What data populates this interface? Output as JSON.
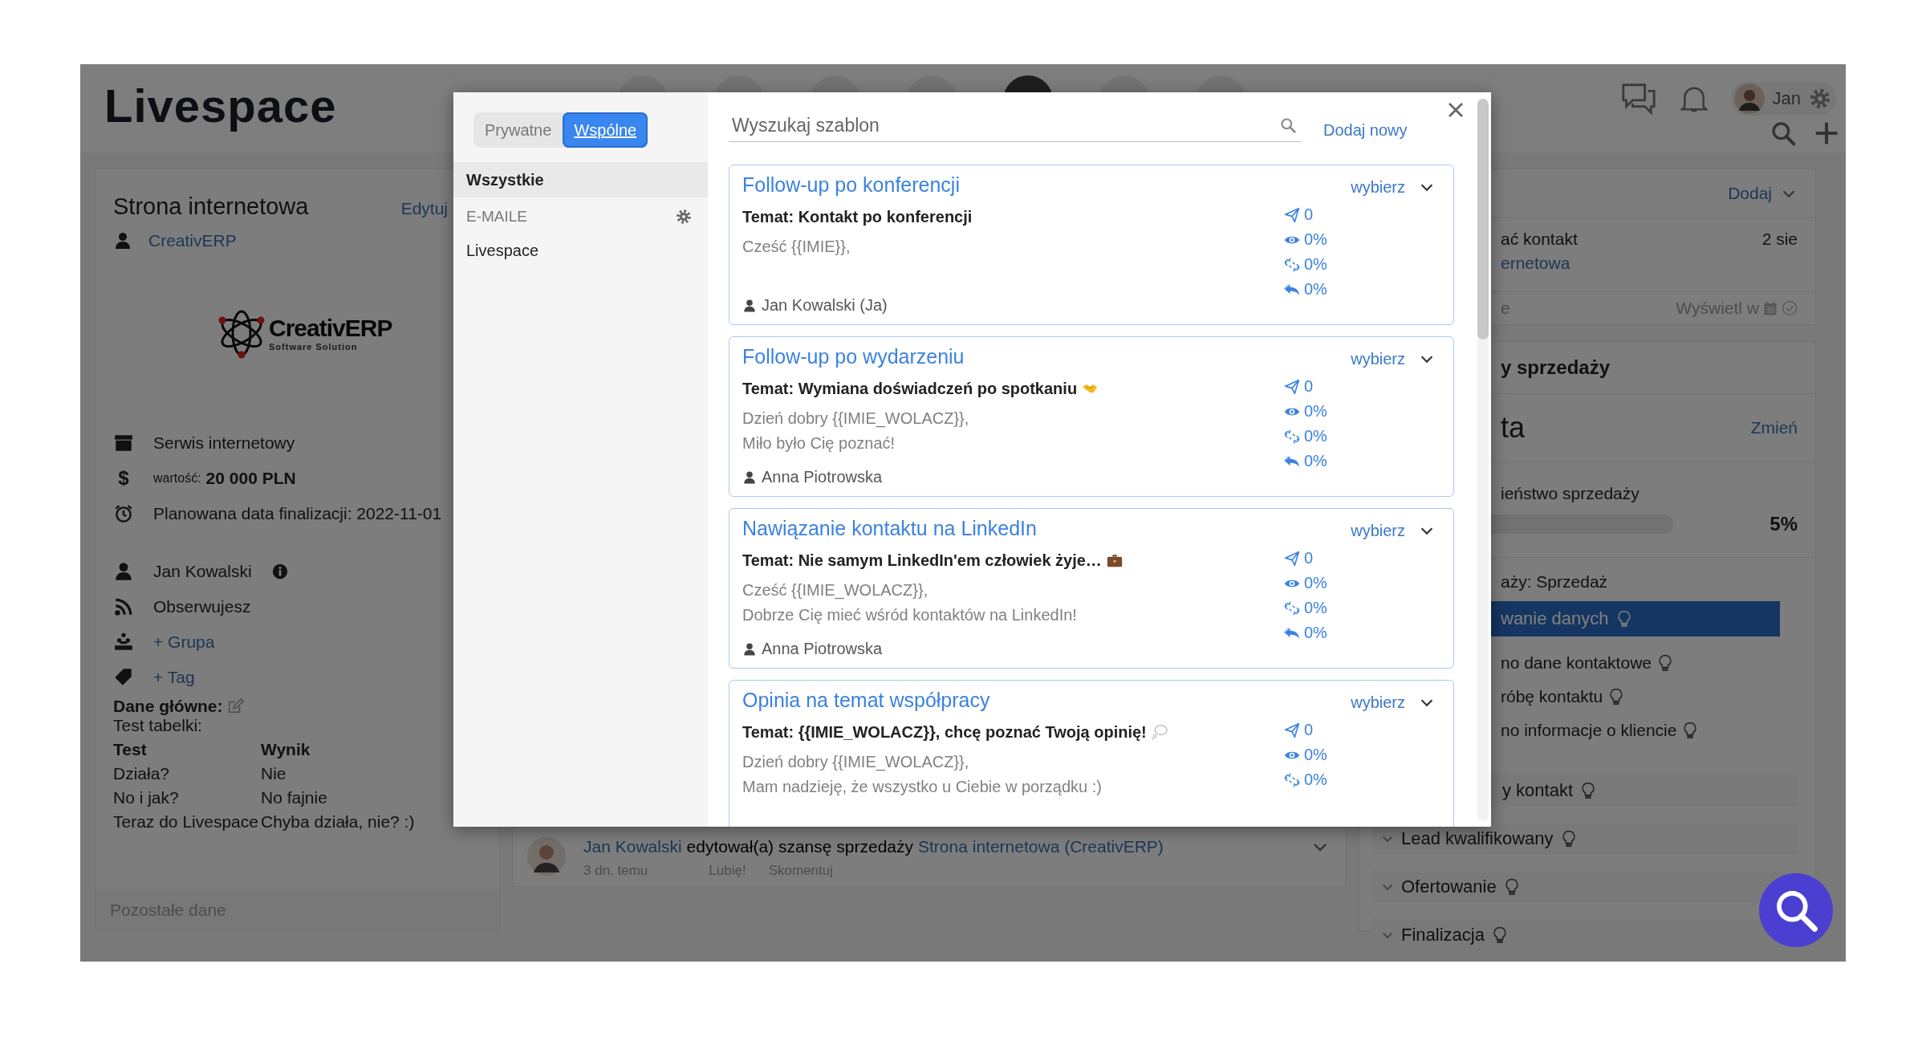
{
  "header": {
    "logo": "Livespace",
    "user_name": "Jan",
    "nav_buttons": [
      {
        "selected": false
      },
      {
        "selected": false
      },
      {
        "selected": false
      },
      {
        "selected": false
      },
      {
        "selected": true
      },
      {
        "selected": false
      },
      {
        "selected": false
      }
    ]
  },
  "deal": {
    "title": "Strona internetowa",
    "edit": "Edytuj",
    "company": "CreativERP",
    "company_logo": {
      "name": "CreativERP",
      "tagline": "Software Solution"
    },
    "details": [
      {
        "kind": "archive",
        "text": "Serwis internetowy"
      },
      {
        "kind": "value",
        "symbol": "$",
        "label": "wartość:",
        "value": "20 000 PLN"
      },
      {
        "kind": "alarm",
        "text": "Planowana data finalizacji: 2022-11-01"
      },
      {
        "kind": "owner",
        "text": "Jan Kowalski"
      },
      {
        "kind": "rss",
        "text": "Obserwujesz"
      },
      {
        "kind": "group",
        "text": "+ Grupa",
        "link": true
      },
      {
        "kind": "tag",
        "text": "+ Tag",
        "link": true
      }
    ],
    "main_data_label": "Dane główne:",
    "table_label": "Test tabelki:",
    "table": {
      "columns": [
        "Test",
        "Wynik"
      ],
      "rows": [
        [
          "Działa?",
          "Nie"
        ],
        [
          "No i jak?",
          "No fajnie"
        ],
        [
          "Teraz do Livespace",
          "Chyba działa, nie? :)"
        ]
      ]
    },
    "more": "Pozostałe dane"
  },
  "activity": {
    "author": "Jan Kowalski",
    "action": "edytował(a) szansę sprzedaży",
    "target": "Strona internetowa (CreativERP)",
    "time": "3 dn. temu",
    "like": "Lubię!",
    "comment": "Skomentuj"
  },
  "side": {
    "tasks": {
      "add": "Dodaj",
      "task_title": "ać kontakt",
      "task_date": "2 sie",
      "task_link": "ernetowa",
      "footer_left": "e",
      "footer_right": "Wyświetl w"
    },
    "pipeline": {
      "title": "y sprzedaży",
      "stage_name": "ta",
      "change": "Zmień",
      "probability_label": "ieństwo sprzedaży",
      "probability": "5%",
      "process_label": "aży: Sprzedaż",
      "stages": [
        {
          "name": "wanie danych",
          "selected": true,
          "tasks": [
            "no dane kontaktowe",
            "róbę kontaktu",
            "no informacje o kliencie"
          ]
        },
        {
          "name": "y kontakt",
          "selected": false
        },
        {
          "name": "Lead kwalifikowany",
          "selected": false
        },
        {
          "name": "Ofertowanie",
          "selected": false
        },
        {
          "name": "Finalizacja",
          "selected": false
        }
      ]
    }
  },
  "template_picker": {
    "scope_tabs": [
      {
        "label": "Prywatne",
        "selected": false
      },
      {
        "label": "Wspólne",
        "selected": true
      }
    ],
    "categories": [
      {
        "kind": "item",
        "label": "Wszystkie",
        "selected": true
      },
      {
        "kind": "section",
        "label": "E-MAILE"
      },
      {
        "kind": "item",
        "label": "Livespace",
        "selected": false
      }
    ],
    "search": {
      "placeholder": "Wyszukaj szablon"
    },
    "add_new": "Dodaj nowy",
    "templates": [
      {
        "kind": "plain",
        "title": "Follow-up po konferencji",
        "select": "wybierz",
        "subject": "Temat: Kontakt po konferencji",
        "body": [
          "Cześć {{IMIE}},"
        ],
        "author": "Jan Kowalski (Ja)",
        "stats": [
          "0",
          "0%",
          "0%",
          "0%"
        ]
      },
      {
        "kind": "handshake",
        "title": "Follow-up po wydarzeniu",
        "select": "wybierz",
        "subject": "Temat: Wymiana doświadczeń po spotkaniu",
        "body": [
          "Dzień dobry {{IMIE_WOLACZ}},",
          "Miło było Cię poznać!"
        ],
        "author": "Anna Piotrowska",
        "stats": [
          "0",
          "0%",
          "0%",
          "0%"
        ]
      },
      {
        "kind": "briefcase",
        "title": "Nawiązanie kontaktu na LinkedIn",
        "select": "wybierz",
        "subject": "Temat: Nie samym LinkedIn'em człowiek żyje…",
        "body": [
          "Cześć {{IMIE_WOLACZ}},",
          "Dobrze Cię mieć wśród kontaktów na LinkedIn!"
        ],
        "author": "Anna Piotrowska",
        "stats": [
          "0",
          "0%",
          "0%",
          "0%"
        ]
      },
      {
        "kind": "thought",
        "title": "Opinia na temat współpracy",
        "select": "wybierz",
        "subject": "Temat: {{IMIE_WOLACZ}}, chcę poznać Twoją opinię!",
        "body": [
          "Dzień dobry {{IMIE_WOLACZ}},",
          "Mam nadzieję, że wszystko u Ciebie w porządku :)"
        ],
        "stats": [
          "0",
          "0%",
          "0%"
        ]
      }
    ]
  }
}
